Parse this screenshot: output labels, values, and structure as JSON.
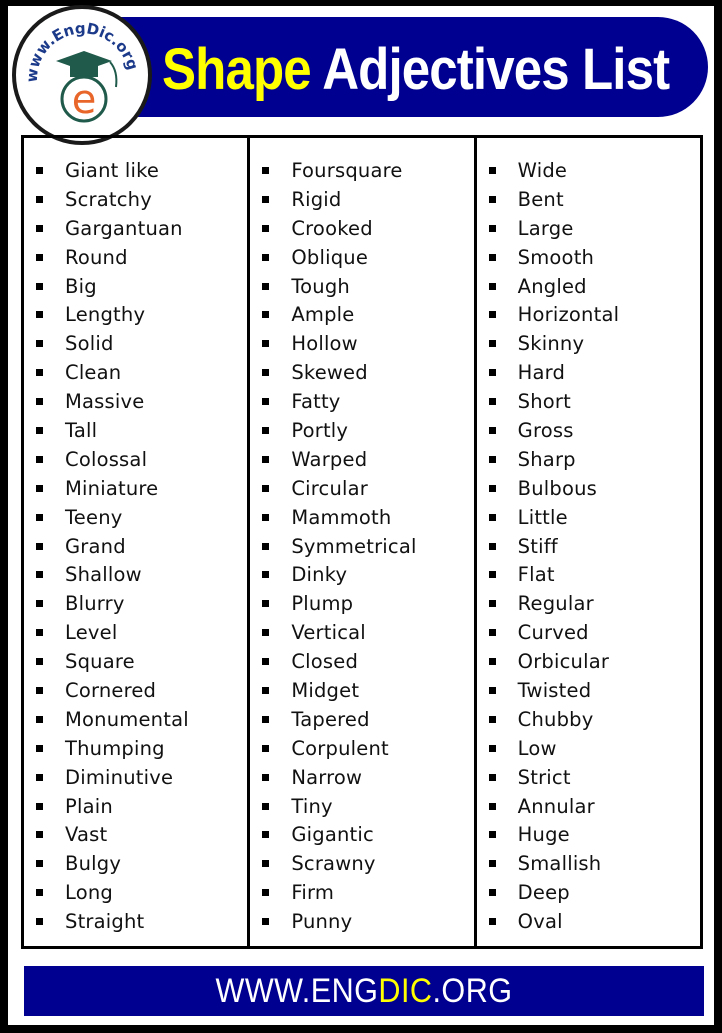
{
  "header": {
    "title_part1": "Shape",
    "title_part2": "Adjectives List",
    "logo_text": "www.EngDic.org",
    "logo_letter": "e"
  },
  "columns": [
    {
      "items": [
        "Giant like",
        "Scratchy",
        "Gargantuan",
        "Round",
        "Big",
        "Lengthy",
        "Solid",
        "Clean",
        "Massive",
        "Tall",
        "Colossal",
        "Miniature",
        "Teeny",
        "Grand",
        "Shallow",
        "Blurry",
        "Level",
        "Square",
        "Cornered",
        "Monumental",
        "Thumping",
        "Diminutive",
        "Plain",
        "Vast",
        "Bulgy",
        "Long",
        "Straight"
      ]
    },
    {
      "items": [
        "Foursquare",
        "Rigid",
        "Crooked",
        "Oblique",
        "Tough",
        "Ample",
        "Hollow",
        "Skewed",
        "Fatty",
        "Portly",
        "Warped",
        "Circular",
        "Mammoth",
        "Symmetrical",
        "Dinky",
        "Plump",
        "Vertical",
        "Closed",
        "Midget",
        "Tapered",
        "Corpulent",
        "Narrow",
        "Tiny",
        "Gigantic",
        "Scrawny",
        "Firm",
        "Punny"
      ]
    },
    {
      "items": [
        "Wide",
        "Bent",
        "Large",
        "Smooth",
        "Angled",
        "Horizontal",
        "Skinny",
        "Hard",
        "Short",
        "Gross",
        "Sharp",
        "Bulbous",
        "Little",
        "Stiff",
        "Flat",
        "Regular",
        "Curved",
        "Orbicular",
        "Twisted",
        "Chubby",
        "Low",
        "Strict",
        "Annular",
        "Huge",
        "Smallish",
        "Deep",
        "Oval"
      ]
    }
  ],
  "footer": {
    "part1": "WWW.ENG",
    "part2": "DIC",
    "part3": ".ORG"
  },
  "colors": {
    "banner": "#000090",
    "title_highlight": "#ffff00",
    "logo_orange": "#e8662a",
    "logo_green": "#1f5a4a"
  }
}
